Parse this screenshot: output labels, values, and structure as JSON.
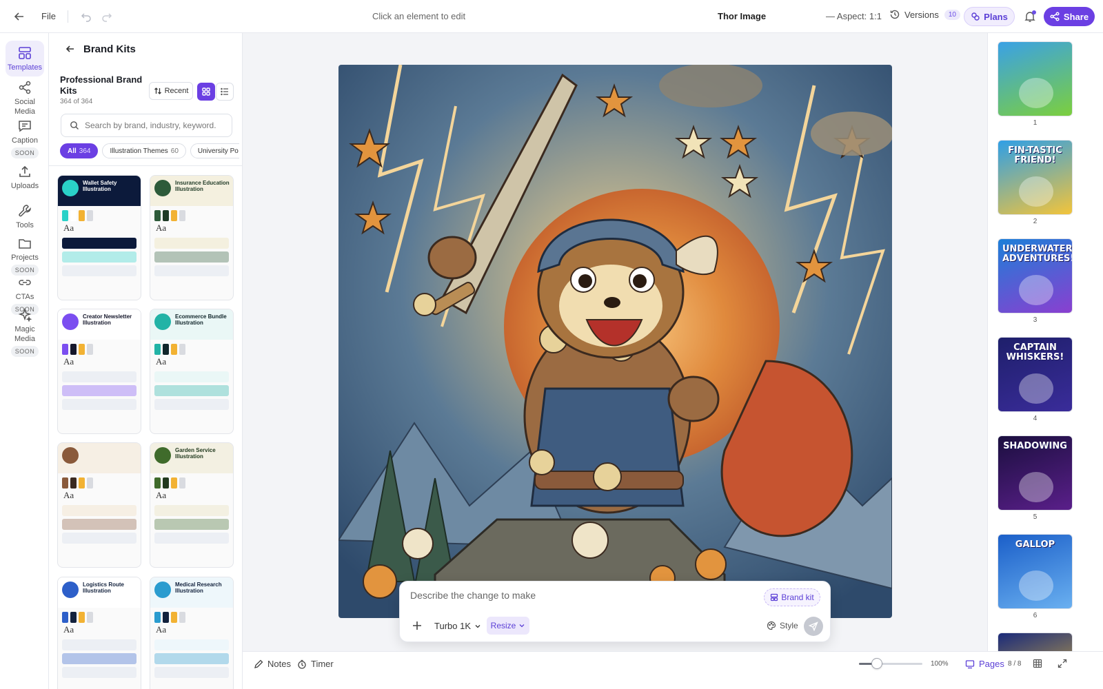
{
  "topbar": {
    "file_label": "File",
    "hint": "Click an element to edit",
    "title": "Thor Image",
    "aspect": "— Aspect: 1:1",
    "versions_label": "Versions",
    "versions_count": "10",
    "plans_label": "Plans",
    "share_label": "Share"
  },
  "rail": {
    "templates": "Templates",
    "social_media": "Social Media",
    "caption": "Caption",
    "uploads": "Uploads",
    "tools": "Tools",
    "projects": "Projects",
    "ctas": "CTAs",
    "magic_media": "Magic Media",
    "soon": "SOON"
  },
  "panel": {
    "title": "Brand Kits",
    "subtitle": "Professional Brand Kits",
    "count": "364 of 364",
    "sort_label": "Recent",
    "search_placeholder": "Search by brand, industry, keyword.",
    "chips": [
      {
        "label": "All",
        "count": "364"
      },
      {
        "label": "Illustration Themes",
        "count": "60"
      },
      {
        "label": "University Po",
        "count": ""
      }
    ],
    "cards": [
      {
        "title": "Wallet Safety Illustration",
        "band": "#0c1a3b",
        "text": "#ffffff",
        "accent": "#2ad1c8"
      },
      {
        "title": "Insurance Education Illustration",
        "band": "#f4f0df",
        "text": "#1f3a26",
        "accent": "#2d5b3a"
      },
      {
        "title": "Creator Newsletter Illustration",
        "band": "#ffffff",
        "text": "#15172b",
        "accent": "#7b4ef0"
      },
      {
        "title": "Ecommerce Bundle Illustration",
        "band": "#eaf7f6",
        "text": "#11262b",
        "accent": "#22b3a6"
      },
      {
        "title": "",
        "band": "#f6efe4",
        "text": "#3b2a20",
        "accent": "#8a5a3b"
      },
      {
        "title": "Garden Service Illustration",
        "band": "#f3f0e2",
        "text": "#223a1f",
        "accent": "#3f6b2b"
      },
      {
        "title": "Logistics Route Illustration",
        "band": "#ffffff",
        "text": "#13223d",
        "accent": "#2d5fc9"
      },
      {
        "title": "Medical Research Illustration",
        "band": "#eef7fb",
        "text": "#13223d",
        "accent": "#2b9ccf"
      }
    ]
  },
  "prompt": {
    "placeholder": "Describe the change to make",
    "brand_kit": "Brand kit",
    "model": "Turbo 1K",
    "resize": "Resize",
    "style": "Style"
  },
  "pages": [
    {
      "num": "1",
      "label": "",
      "bg1": "#3aa1e6",
      "bg2": "#7ccf3d"
    },
    {
      "num": "2",
      "label": "FIN-TASTIC FRIEND!",
      "bg1": "#2f9fe6",
      "bg2": "#f3c43a"
    },
    {
      "num": "3",
      "label": "UNDERWATER ADVENTURES!",
      "bg1": "#1d7fd8",
      "bg2": "#8a3fd0"
    },
    {
      "num": "4",
      "label": "CAPTAIN WHISKERS!",
      "bg1": "#1e1f6b",
      "bg2": "#3a2c9a"
    },
    {
      "num": "5",
      "label": "SHADOWING",
      "bg1": "#1b0f3f",
      "bg2": "#5a1f8a"
    },
    {
      "num": "6",
      "label": "GALLOP",
      "bg1": "#1b5fc9",
      "bg2": "#6ab0f0"
    },
    {
      "num": "",
      "label": "",
      "bg1": "#1a2a7a",
      "bg2": "#f0c53a"
    }
  ],
  "bottombar": {
    "notes": "Notes",
    "timer": "Timer",
    "zoom": "100%",
    "zoom_slider_fraction": 0.28,
    "pages_label": "Pages",
    "page_count": "8 / 8"
  }
}
